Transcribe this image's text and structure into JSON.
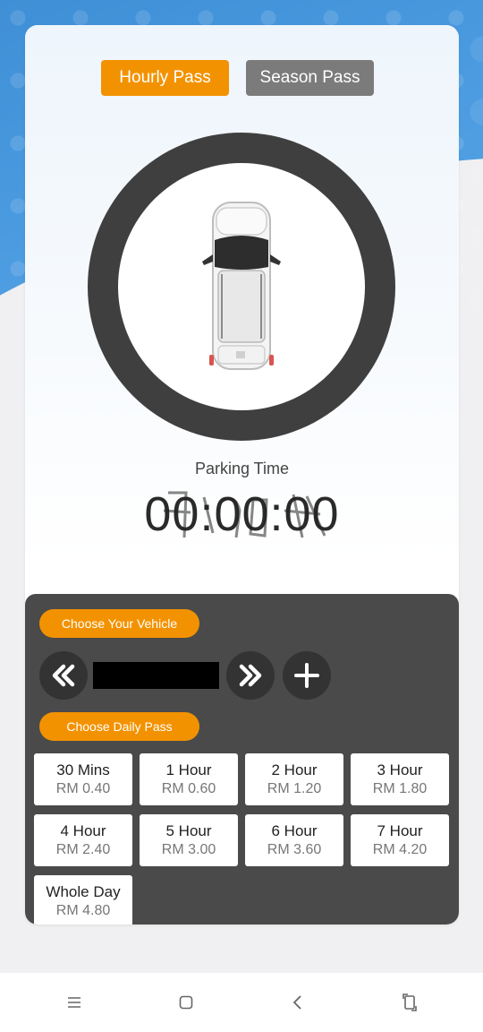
{
  "tabs": {
    "hourly": "Hourly Pass",
    "season": "Season Pass"
  },
  "timer": {
    "label": "Parking Time",
    "value": "00:00:00"
  },
  "vehicle": {
    "choose_label": "Choose Your Vehicle"
  },
  "daily": {
    "choose_label": "Choose Daily Pass",
    "passes": [
      {
        "title": "30 Mins",
        "price": "RM 0.40"
      },
      {
        "title": "1 Hour",
        "price": "RM 0.60"
      },
      {
        "title": "2 Hour",
        "price": "RM 1.20"
      },
      {
        "title": "3 Hour",
        "price": "RM 1.80"
      },
      {
        "title": "4 Hour",
        "price": "RM 2.40"
      },
      {
        "title": "5 Hour",
        "price": "RM 3.00"
      },
      {
        "title": "6 Hour",
        "price": "RM 3.60"
      },
      {
        "title": "7 Hour",
        "price": "RM 4.20"
      },
      {
        "title": "Whole Day",
        "price": "RM 4.80"
      }
    ]
  },
  "colors": {
    "accent": "#f39200",
    "inactive_tab": "#7b7b7b",
    "panel": "#4a4a4a",
    "ring": "#3f3f3f"
  },
  "icons": {
    "prev": "double-chevron-left-icon",
    "next": "double-chevron-right-icon",
    "add": "plus-icon",
    "nav_menu": "menu-icon",
    "nav_home": "home-square-icon",
    "nav_back": "back-chevron-icon",
    "nav_rotate": "rotate-icon"
  }
}
